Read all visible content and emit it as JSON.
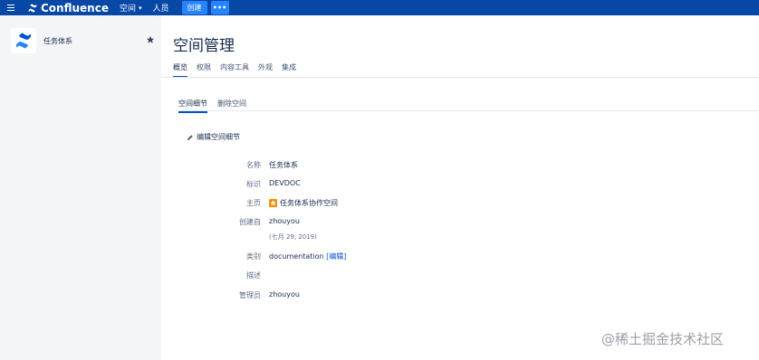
{
  "topbar": {
    "brand_name": "Confluence",
    "nav_spaces": "空间",
    "nav_people": "人员",
    "create_label": "创建",
    "more_label": "•••",
    "bg_color": "#0747a6",
    "accent_color": "#2684ff"
  },
  "sidebar": {
    "space_name": "任务体系",
    "collapse_glyph": "⁞"
  },
  "main": {
    "title": "空间管理",
    "tabs": [
      {
        "label": "概览",
        "active": true
      },
      {
        "label": "权限"
      },
      {
        "label": "内容工具"
      },
      {
        "label": "外观"
      },
      {
        "label": "集成"
      }
    ],
    "subtabs": [
      {
        "label": "空间细节",
        "active": true
      },
      {
        "label": "删除空间"
      }
    ],
    "edit_link": "编辑空间细节",
    "details": {
      "name_label": "名称",
      "name_value": "任务体系",
      "key_label": "标识",
      "key_value": "DEVDOC",
      "home_label": "主页",
      "home_value": "任务体系协作空间",
      "created_label": "创建自",
      "created_value": "zhouyou",
      "created_date": "(七月 29, 2019)",
      "category_label": "类别",
      "category_value": "documentation",
      "category_edit": "[编辑]",
      "desc_label": "描述",
      "desc_value": "",
      "admin_label": "管理员",
      "admin_value": "zhouyou"
    }
  },
  "watermark": "@稀土掘金技术社区"
}
